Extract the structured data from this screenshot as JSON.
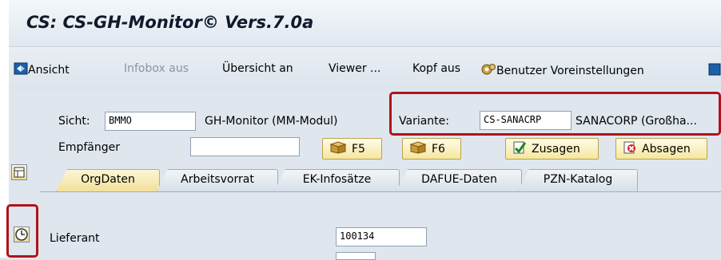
{
  "title": "CS: CS-GH-Monitor© Vers.7.0a",
  "toolbar": {
    "ansicht": "Ansicht",
    "infobox_aus": "Infobox aus",
    "uebersicht_an": "Übersicht an",
    "viewer": "Viewer ...",
    "kopf_aus": "Kopf aus",
    "benutzer_voreinstellungen": "Benutzer Voreinstellungen"
  },
  "header": {
    "sicht_label": "Sicht:",
    "sicht_value": "BMMO",
    "sicht_desc": "GH-Monitor (MM-Modul)",
    "variante_label": "Variante:",
    "variante_value": "CS-SANACRP",
    "variante_desc": "SANACORP (Großha...",
    "empfaenger_label": "Empfänger",
    "empfaenger_value": ""
  },
  "buttons": {
    "f5": "F5",
    "f6": "F6",
    "zusagen": "Zusagen",
    "absagen": "Absagen"
  },
  "tabs": [
    {
      "label": "OrgDaten",
      "active": true
    },
    {
      "label": "Arbeitsvorrat",
      "active": false
    },
    {
      "label": "EK-Infosätze",
      "active": false
    },
    {
      "label": "DAFUE-Daten",
      "active": false
    },
    {
      "label": "PZN-Katalog",
      "active": false
    }
  ],
  "orgdaten": {
    "lieferant_label": "Lieferant",
    "lieferant_value": "100134"
  },
  "colors": {
    "highlight": "#b0121b",
    "background": "#dfe6ee",
    "active_tab": "#f1e09a"
  }
}
